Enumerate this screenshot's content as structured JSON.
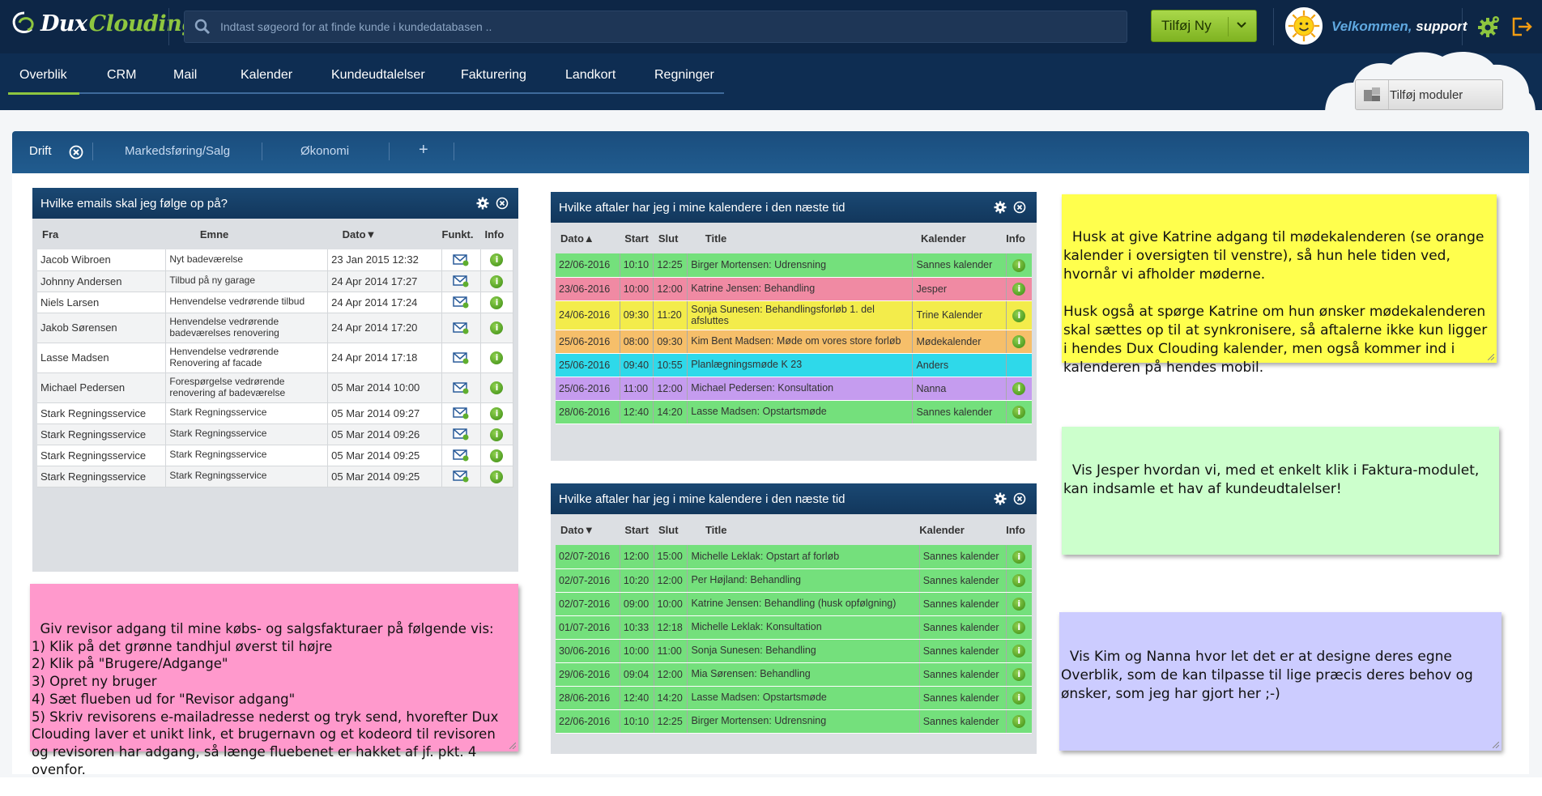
{
  "brand": {
    "logo_part1": "Dux",
    "logo_part2": "Clouding",
    "accent": "#8ec63f"
  },
  "search": {
    "placeholder": "Indtast søgeord for at finde kunde i kundedatabasen .."
  },
  "add_new": {
    "label": "Tilføj Ny"
  },
  "user": {
    "welcome": "Velkommen,",
    "name": "support"
  },
  "nav": {
    "tabs": [
      "Overblik",
      "CRM",
      "Mail",
      "Kalender",
      "Kundeudtalelser",
      "Fakturering",
      "Landkort",
      "Regninger"
    ],
    "active": "Overblik"
  },
  "add_modules": {
    "label": "Tilføj moduler"
  },
  "subtabs": {
    "items": [
      "Drift",
      "Markedsføring/Salg",
      "Økonomi"
    ],
    "add": "+"
  },
  "email_widget": {
    "title": "Hvilke emails skal jeg følge op på?",
    "headers": [
      "Fra",
      "Emne",
      "Dato▼",
      "Funkt.",
      "Info"
    ],
    "rows": [
      {
        "from": "Jacob Wibroen",
        "subject": "Nyt badeværelse",
        "date": "23 Jan 2015 12:32"
      },
      {
        "from": "Johnny Andersen",
        "subject": "Tilbud på ny garage",
        "date": "24 Apr 2014 17:27"
      },
      {
        "from": "Niels Larsen",
        "subject": "Henvendelse vedrørende tilbud",
        "date": "24 Apr 2014 17:24"
      },
      {
        "from": "Jakob Sørensen",
        "subject": "Henvendelse vedrørende badeværelses renovering",
        "date": "24 Apr 2014 17:20"
      },
      {
        "from": "Lasse Madsen",
        "subject": "Henvendelse vedrørende Renovering af facade",
        "date": "24 Apr 2014 17:18"
      },
      {
        "from": "Michael Pedersen",
        "subject": "Forespørgelse vedrørende renovering af badeværelse",
        "date": "05 Mar 2014 10:00"
      },
      {
        "from": "Stark Regningsservice",
        "subject": "Stark Regningsservice",
        "date": "05 Mar 2014 09:27"
      },
      {
        "from": "Stark Regningsservice",
        "subject": "Stark Regningsservice",
        "date": "05 Mar 2014 09:26"
      },
      {
        "from": "Stark Regningsservice",
        "subject": "Stark Regningsservice",
        "date": "05 Mar 2014 09:25"
      },
      {
        "from": "Stark Regningsservice",
        "subject": "Stark Regningsservice",
        "date": "05 Mar 2014 09:25"
      }
    ]
  },
  "cal1": {
    "title": "Hvilke aftaler har jeg i mine kalendere i den næste tid",
    "headers": [
      "Dato▲",
      "Start",
      "Slut",
      "Title",
      "Kalender",
      "Info"
    ],
    "rows": [
      {
        "date": "22/06-2016",
        "start": "10:10",
        "end": "12:25",
        "title": "Birger Mortensen: Udrensning",
        "cal": "Sannes kalender",
        "color": "#74e07c",
        "info": true
      },
      {
        "date": "23/06-2016",
        "start": "10:00",
        "end": "12:00",
        "title": "Katrine Jensen: Behandling",
        "cal": "Jesper",
        "color": "#f08aa3",
        "info": true
      },
      {
        "date": "24/06-2016",
        "start": "09:30",
        "end": "11:20",
        "title": "Sonja Sunesen: Behandlingsforløb 1. del afsluttes",
        "cal": "Trine Kalender",
        "color": "#f3ec4b",
        "info": true
      },
      {
        "date": "25/06-2016",
        "start": "08:00",
        "end": "09:30",
        "title": "Kim Bent Madsen: Møde om vores store forløb",
        "cal": "Mødekalender",
        "color": "#f6bf6a",
        "info": true
      },
      {
        "date": "25/06-2016",
        "start": "09:40",
        "end": "10:55",
        "title": "Planlægningsmøde K 23",
        "cal": "Anders",
        "color": "#2ed9ea",
        "info": false
      },
      {
        "date": "25/06-2016",
        "start": "11:00",
        "end": "12:00",
        "title": "Michael Pedersen: Konsultation",
        "cal": "Nanna",
        "color": "#c59cef",
        "info": true
      },
      {
        "date": "28/06-2016",
        "start": "12:40",
        "end": "14:20",
        "title": "Lasse Madsen: Opstartsmøde",
        "cal": "Sannes kalender",
        "color": "#74e07c",
        "info": true
      }
    ]
  },
  "cal2": {
    "title": "Hvilke aftaler har jeg i mine kalendere i den næste tid",
    "headers": [
      "Dato▼",
      "Start",
      "Slut",
      "Title",
      "Kalender",
      "Info"
    ],
    "rows": [
      {
        "date": "02/07-2016",
        "start": "12:00",
        "end": "15:00",
        "title": "Michelle Leklak: Opstart af forløb",
        "cal": "Sannes kalender",
        "color": "#74e07c",
        "info": true
      },
      {
        "date": "02/07-2016",
        "start": "10:20",
        "end": "12:00",
        "title": "Per Højland: Behandling",
        "cal": "Sannes kalender",
        "color": "#74e07c",
        "info": true
      },
      {
        "date": "02/07-2016",
        "start": "09:00",
        "end": "10:00",
        "title": "Katrine Jensen: Behandling (husk opfølgning)",
        "cal": "Sannes kalender",
        "color": "#74e07c",
        "info": true
      },
      {
        "date": "01/07-2016",
        "start": "10:33",
        "end": "12:18",
        "title": "Michelle Leklak: Konsultation",
        "cal": "Sannes kalender",
        "color": "#74e07c",
        "info": true
      },
      {
        "date": "30/06-2016",
        "start": "10:00",
        "end": "11:00",
        "title": "Sonja Sunesen: Behandling",
        "cal": "Sannes kalender",
        "color": "#74e07c",
        "info": true
      },
      {
        "date": "29/06-2016",
        "start": "09:04",
        "end": "12:00",
        "title": "Mia Sørensen: Behandling",
        "cal": "Sannes kalender",
        "color": "#74e07c",
        "info": true
      },
      {
        "date": "28/06-2016",
        "start": "12:40",
        "end": "14:20",
        "title": "Lasse Madsen: Opstartsmøde",
        "cal": "Sannes kalender",
        "color": "#74e07c",
        "info": true
      },
      {
        "date": "22/06-2016",
        "start": "10:10",
        "end": "12:25",
        "title": "Birger Mortensen: Udrensning",
        "cal": "Sannes kalender",
        "color": "#74e07c",
        "info": true
      }
    ]
  },
  "notes": {
    "yellow": {
      "text": "Husk at give Katrine adgang til mødekalenderen (se orange kalender i oversigten til venstre), så hun hele tiden ved, hvornår vi afholder møderne.\n\nHusk også at spørge Katrine om hun ønsker mødekalenderen skal sættes op til at synkronisere, så aftalerne ikke kun ligger i hendes Dux Clouding kalender, men også kommer ind i kalenderen på hendes mobil.",
      "color": "#ffff4d"
    },
    "green": {
      "text": "Vis Jesper hvordan vi, med et enkelt klik i Faktura-modulet, kan indsamle et hav af kundeudtalelser!",
      "color": "#ccffcc"
    },
    "purple": {
      "text": "Vis Kim og Nanna hvor let det er at designe deres egne Overblik, som de kan tilpasse til lige præcis deres behov og ønsker, som jeg har gjort her ;-)",
      "color": "#ccccff"
    },
    "pink": {
      "text": "Giv revisor adgang til mine købs- og salgsfakturaer på følgende vis:\n1) Klik på det grønne tandhjul øverst til højre\n2) Klik på \"Brugere/Adgange\"\n3) Opret ny bruger\n4) Sæt flueben ud for \"Revisor adgang\"\n5) Skriv revisorens e-mailadresse nederst og tryk send, hvorefter Dux Clouding laver et unikt link, et brugernavn og et kodeord til revisoren og revisoren har adgang, så længe fluebenet er hakket af jf. pkt. 4 ovenfor.",
      "color": "#ff99cc"
    }
  }
}
